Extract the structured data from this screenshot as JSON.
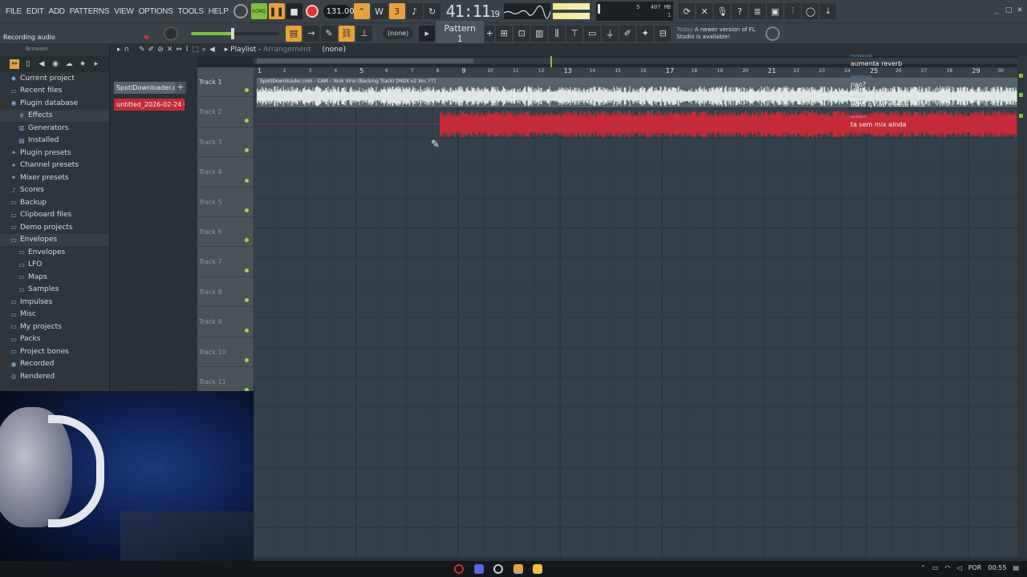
{
  "menu": [
    "FILE",
    "EDIT",
    "ADD",
    "PATTERNS",
    "VIEW",
    "OPTIONS",
    "TOOLS",
    "HELP"
  ],
  "transport": {
    "song_label": "SONG",
    "tempo": "131.000",
    "time_main": "41:11",
    "time_sub": "19",
    "time_label": "B:S:T",
    "cpu_a": "5",
    "ram": "407 MB",
    "poly": "1"
  },
  "hint": {
    "text": "Recording audio"
  },
  "pattern": {
    "none_label": "(none)",
    "selected": "Pattern 1",
    "add": "+"
  },
  "update_notice": {
    "when": "Today",
    "text": "A newer version of FL Studio is available!"
  },
  "browser": {
    "title": "Browser",
    "items": [
      {
        "label": "Current project",
        "icon": "project-icon",
        "level": "top"
      },
      {
        "label": "Recent files",
        "icon": "folder-icon",
        "level": "top"
      },
      {
        "label": "Plugin database",
        "icon": "plugin-icon",
        "level": "top"
      },
      {
        "label": "Effects",
        "icon": "effects-icon",
        "level": "sub"
      },
      {
        "label": "Generators",
        "icon": "generators-icon",
        "level": "sub"
      },
      {
        "label": "Installed",
        "icon": "installed-icon",
        "level": "sub"
      },
      {
        "label": "Plugin presets",
        "icon": "preset-icon",
        "level": "top"
      },
      {
        "label": "Channel presets",
        "icon": "preset-icon",
        "level": "top"
      },
      {
        "label": "Mixer presets",
        "icon": "preset-icon",
        "level": "top"
      },
      {
        "label": "Scores",
        "icon": "note-icon",
        "level": "top"
      },
      {
        "label": "Backup",
        "icon": "folder-icon",
        "level": "top"
      },
      {
        "label": "Clipboard files",
        "icon": "folder-icon",
        "level": "top"
      },
      {
        "label": "Demo projects",
        "icon": "folder-icon",
        "level": "top"
      },
      {
        "label": "Envelopes",
        "icon": "folder-icon",
        "level": "top"
      },
      {
        "label": "Envelopes",
        "icon": "folder-icon",
        "level": "sub"
      },
      {
        "label": "LFO",
        "icon": "folder-icon",
        "level": "sub"
      },
      {
        "label": "Maps",
        "icon": "folder-icon",
        "level": "sub"
      },
      {
        "label": "Samples",
        "icon": "folder-icon",
        "level": "sub"
      },
      {
        "label": "Impulses",
        "icon": "folder-icon",
        "level": "top"
      },
      {
        "label": "Misc",
        "icon": "folder-icon",
        "level": "top"
      },
      {
        "label": "My projects",
        "icon": "folder-icon",
        "level": "top"
      },
      {
        "label": "Packs",
        "icon": "folder-icon",
        "level": "top"
      },
      {
        "label": "Project bones",
        "icon": "folder-icon",
        "level": "top"
      },
      {
        "label": "Recorded",
        "icon": "record-icon",
        "level": "top"
      },
      {
        "label": "Rendered",
        "icon": "render-icon",
        "level": "top"
      }
    ]
  },
  "picker": {
    "clips": [
      "SpotiDownloader.co...",
      "untitled_2026-02-24 00-..."
    ]
  },
  "playlist": {
    "title": "Playlist",
    "subtitle": "Arrangement",
    "pattern": "(none)",
    "tracks": [
      "Track 1",
      "Track 2",
      "Track 3",
      "Track 4",
      "Track 5",
      "Track 6",
      "Track 7",
      "Track 8",
      "Track 9",
      "Track 10",
      "Track 11"
    ],
    "bars": [
      "1",
      "2",
      "3",
      "4",
      "5",
      "6",
      "7",
      "8",
      "9",
      "10",
      "11",
      "12",
      "13",
      "14",
      "15",
      "16",
      "17",
      "18",
      "19",
      "20",
      "21",
      "22",
      "23",
      "24",
      "25",
      "26",
      "27",
      "28",
      "29",
      "30"
    ],
    "clip1_name": "SpotiDownloader.com - CAM - Yonk Vino (Backing Track) [MDX v2 Voc FT]"
  },
  "chat": [
    {
      "user": "mamboastt",
      "text": "aumenta reverb",
      "user_color": "#6aa8e8"
    },
    {
      "user": "mamboastt",
      "text": "nao?",
      "user_color": "#6aa8e8"
    },
    {
      "user": "ewokart",
      "text": "acho q nao e essa nota",
      "user_color": "#b8c2c8"
    },
    {
      "user": "ewokart",
      "text": "ta sem mix ainda",
      "user_color": "#b8c2c8"
    }
  ],
  "tray": {
    "lang": "POR",
    "time": "00:55"
  },
  "colors": {
    "accent": "#e9a23b",
    "green": "#7fc23c",
    "clip_red": "#c32b36",
    "grid": "#34414b"
  }
}
